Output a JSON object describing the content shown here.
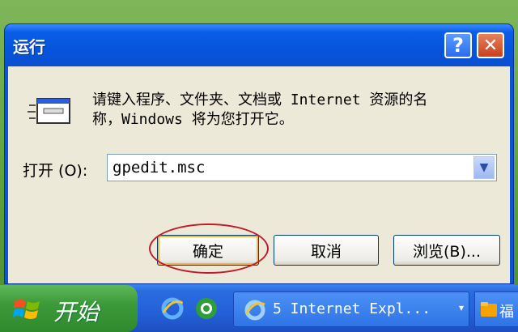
{
  "window": {
    "title": "运行",
    "help_label": "?",
    "close_label": "✕"
  },
  "dialog": {
    "description_line1": "请键入程序、文件夹、文档或 Internet 资源的名",
    "description_line2": "称，Windows 将为您打开它。",
    "open_label": "打开 (O):",
    "command_value": "gpedit.msc",
    "dropdown_arrow": "▼",
    "ok_label": "确定",
    "cancel_label": "取消",
    "browse_label": "浏览(B)..."
  },
  "taskbar": {
    "start_label": "开始",
    "task_label": "5 Internet Expl...",
    "task_arrow": "▾",
    "tray_label": "福"
  },
  "colors": {
    "titlebar": "#0654dc",
    "client": "#ece9d8",
    "highlight_ring": "#c21a2a",
    "start_green": "#3c9a3a",
    "taskbar_blue": "#2460d8"
  },
  "icons": [
    "run-program-icon",
    "help-icon",
    "close-icon",
    "chevron-down-icon",
    "windows-logo-icon",
    "internet-explorer-icon",
    "ie-green-icon",
    "folder-app-icon"
  ]
}
